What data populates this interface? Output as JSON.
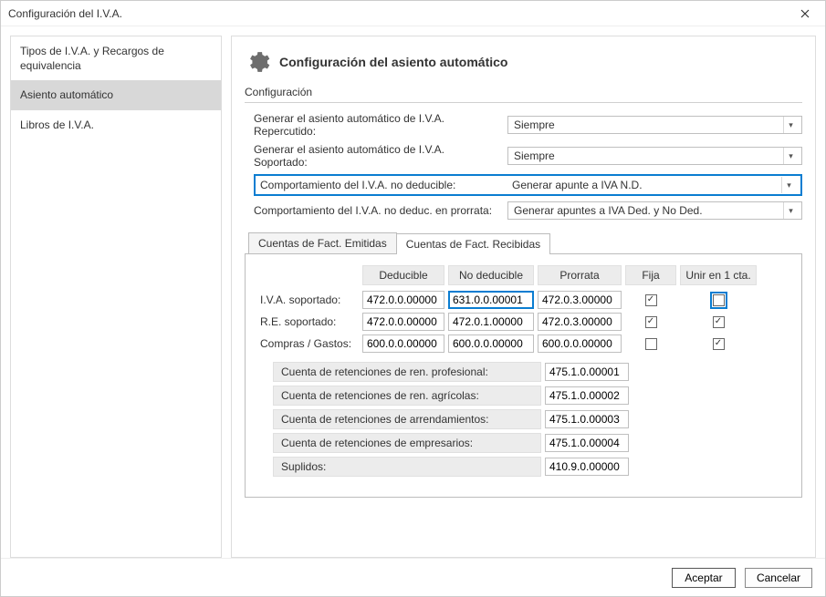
{
  "window": {
    "title": "Configuración del I.V.A."
  },
  "sidebar": {
    "items": [
      {
        "label": "Tipos de I.V.A. y Recargos de equivalencia"
      },
      {
        "label": "Asiento automático"
      },
      {
        "label": "Libros de I.V.A."
      }
    ],
    "active_index": 1
  },
  "header": {
    "title": "Configuración del asiento automático"
  },
  "section": {
    "title": "Configuración"
  },
  "form": {
    "rows": [
      {
        "label": "Generar el asiento automático de I.V.A. Repercutido:",
        "value": "Siempre"
      },
      {
        "label": "Generar el asiento automático de I.V.A. Soportado:",
        "value": "Siempre"
      },
      {
        "label": "Comportamiento del I.V.A. no deducible:",
        "value": "Generar apunte a IVA N.D."
      },
      {
        "label": "Comportamiento del I.V.A. no deduc. en prorrata:",
        "value": "Generar apuntes a IVA Ded. y No Ded."
      }
    ],
    "highlight_index": 2
  },
  "tabs": {
    "items": [
      {
        "label": "Cuentas de Fact. Emitidas"
      },
      {
        "label": "Cuentas de Fact. Recibidas"
      }
    ],
    "active_index": 1
  },
  "grid": {
    "headers": [
      "Deducible",
      "No deducible",
      "Prorrata",
      "Fija",
      "Unir en 1 cta."
    ],
    "rows": [
      {
        "label": "I.V.A. soportado:",
        "deducible": "472.0.0.00000",
        "nodeducible": "631.0.0.00001",
        "prorrata": "472.0.3.00000",
        "fija": true,
        "unir": false,
        "hl_nodeducible": true,
        "hl_unir": true
      },
      {
        "label": "R.E. soportado:",
        "deducible": "472.0.0.00000",
        "nodeducible": "472.0.1.00000",
        "prorrata": "472.0.3.00000",
        "fija": true,
        "unir": true
      },
      {
        "label": "Compras / Gastos:",
        "deducible": "600.0.0.00000",
        "nodeducible": "600.0.0.00000",
        "prorrata": "600.0.0.00000",
        "fija": false,
        "unir": true
      }
    ],
    "retentions": [
      {
        "label": "Cuenta de retenciones de ren. profesional:",
        "value": "475.1.0.00001"
      },
      {
        "label": "Cuenta de retenciones de ren. agrícolas:",
        "value": "475.1.0.00002"
      },
      {
        "label": "Cuenta de retenciones de arrendamientos:",
        "value": "475.1.0.00003"
      },
      {
        "label": "Cuenta de retenciones de empresarios:",
        "value": "475.1.0.00004"
      },
      {
        "label": "Suplidos:",
        "value": "410.9.0.00000"
      }
    ]
  },
  "footer": {
    "accept": "Aceptar",
    "cancel": "Cancelar"
  }
}
